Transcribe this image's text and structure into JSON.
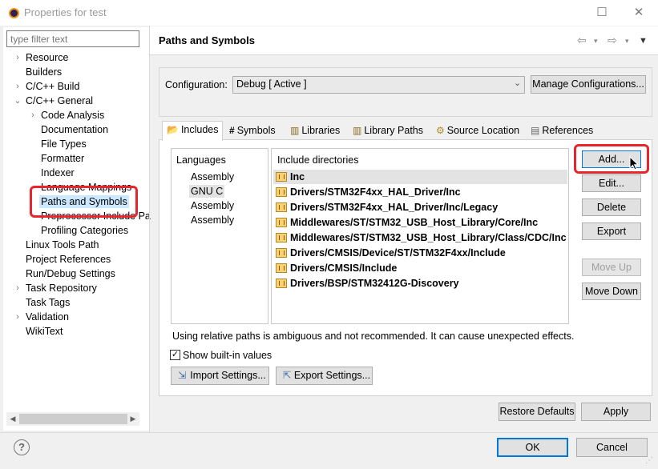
{
  "window": {
    "title": "Properties for test"
  },
  "filter": {
    "placeholder": "type filter text"
  },
  "tree": [
    {
      "label": "Resource",
      "chev": "›"
    },
    {
      "label": "Builders",
      "chev": ""
    },
    {
      "label": "C/C++ Build",
      "chev": "›"
    },
    {
      "label": "C/C++ General",
      "chev": "⌄"
    },
    {
      "label": "Code Analysis",
      "chev": "›"
    },
    {
      "label": "Documentation",
      "chev": ""
    },
    {
      "label": "File Types",
      "chev": ""
    },
    {
      "label": "Formatter",
      "chev": ""
    },
    {
      "label": "Indexer",
      "chev": ""
    },
    {
      "label": "Language Mappings",
      "chev": ""
    },
    {
      "label": "Paths and Symbols",
      "chev": ""
    },
    {
      "label": "Preprocessor Include Pa",
      "chev": ""
    },
    {
      "label": "Profiling Categories",
      "chev": ""
    },
    {
      "label": "Linux Tools Path",
      "chev": ""
    },
    {
      "label": "Project References",
      "chev": ""
    },
    {
      "label": "Run/Debug Settings",
      "chev": ""
    },
    {
      "label": "Task Repository",
      "chev": "›"
    },
    {
      "label": "Task Tags",
      "chev": ""
    },
    {
      "label": "Validation",
      "chev": "›"
    },
    {
      "label": "WikiText",
      "chev": ""
    }
  ],
  "page": {
    "title": "Paths and Symbols"
  },
  "config": {
    "label": "Configuration:",
    "value": "Debug  [ Active ]",
    "manage_label": "Manage Configurations..."
  },
  "tabs": [
    {
      "label": "Includes",
      "icon": "includes-icon"
    },
    {
      "label": "Symbols",
      "icon": "symbols-icon"
    },
    {
      "label": "Libraries",
      "icon": "libraries-icon"
    },
    {
      "label": "Library Paths",
      "icon": "library-paths-icon"
    },
    {
      "label": "Source Location",
      "icon": "source-location-icon"
    },
    {
      "label": "References",
      "icon": "references-icon"
    }
  ],
  "languages": {
    "header": "Languages",
    "items": [
      "Assembly",
      "GNU C",
      "Assembly",
      "Assembly"
    ]
  },
  "includes": {
    "header": "Include directories",
    "items": [
      "Inc",
      "Drivers/STM32F4xx_HAL_Driver/Inc",
      "Drivers/STM32F4xx_HAL_Driver/Inc/Legacy",
      "Middlewares/ST/STM32_USB_Host_Library/Core/Inc",
      "Middlewares/ST/STM32_USB_Host_Library/Class/CDC/Inc",
      "Drivers/CMSIS/Device/ST/STM32F4xx/Include",
      "Drivers/CMSIS/Include",
      "Drivers/BSP/STM32412G-Discovery"
    ]
  },
  "side_buttons": {
    "add": "Add...",
    "edit": "Edit...",
    "delete": "Delete",
    "export": "Export",
    "move_up": "Move Up",
    "move_down": "Move Down"
  },
  "hint": "Using relative paths is ambiguous and not recommended. It can cause unexpected effects.",
  "show_builtin": {
    "label": "Show built-in values",
    "checked": true
  },
  "import_label": "Import Settings...",
  "export_label": "Export Settings...",
  "restore_label": "Restore Defaults",
  "apply_label": "Apply",
  "ok_label": "OK",
  "cancel_label": "Cancel",
  "colors": {
    "highlight": "#e8242d",
    "selection": "#cce8ff",
    "ok_border": "#0078d7"
  }
}
